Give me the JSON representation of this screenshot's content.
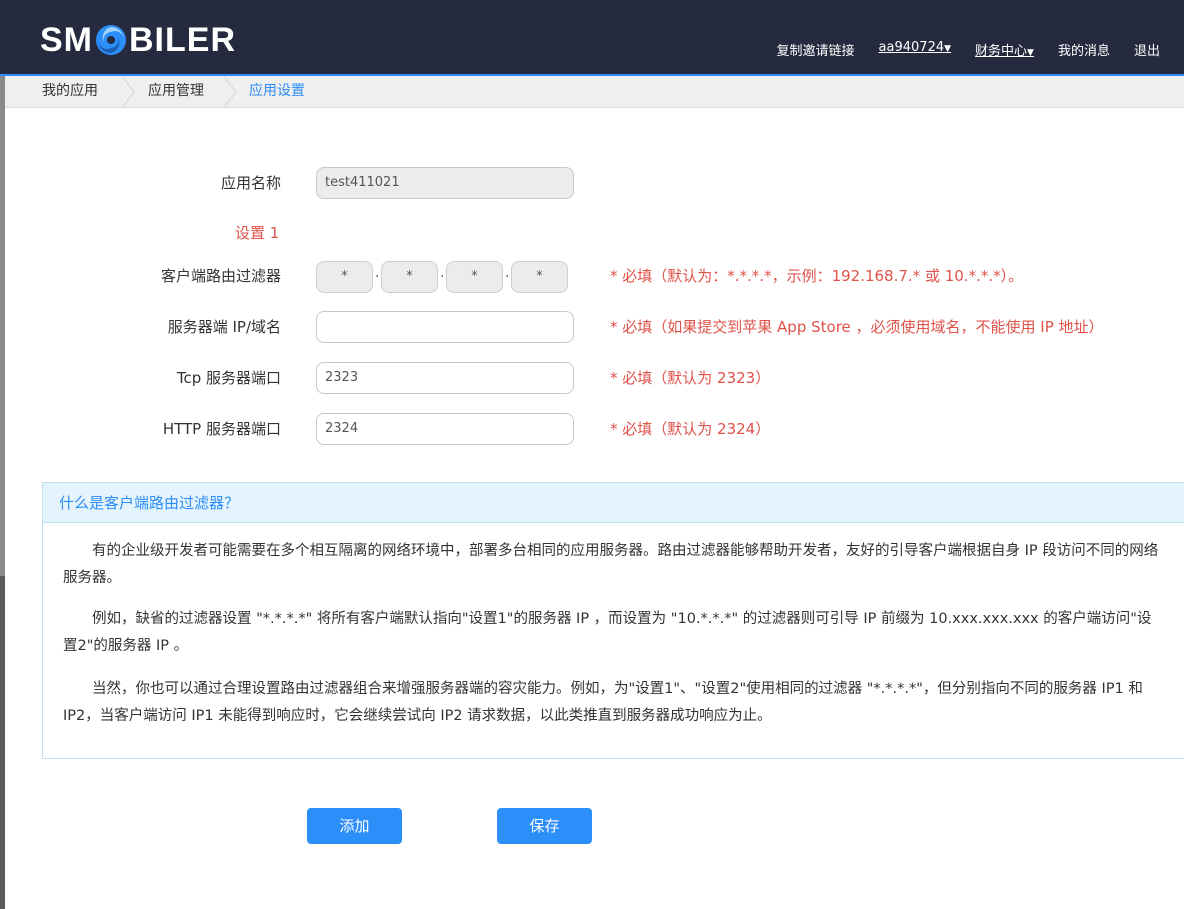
{
  "header": {
    "logo_left": "SM",
    "logo_right": "BILER",
    "nav": {
      "copy_invite": "复制邀请链接",
      "user": "aa940724",
      "finance": "财务中心",
      "messages": "我的消息",
      "logout": "退出"
    }
  },
  "breadcrumb": [
    "我的应用",
    "应用管理",
    "应用设置"
  ],
  "form": {
    "app_name_label": "应用名称",
    "app_name_value": "test411021",
    "section_title": "设置 1",
    "filter_label": "客户端路由过滤器",
    "filter_segments": [
      "*",
      "*",
      "*",
      "*"
    ],
    "filter_hint": "* 必填（默认为：*.*.*.*，示例：192.168.7.* 或 10.*.*.*）。",
    "server_ip_label": "服务器端 IP/域名",
    "server_ip_value": "",
    "server_ip_hint": "* 必填（如果提交到苹果 App Store ，必须使用域名，不能使用 IP 地址）",
    "tcp_label": "Tcp 服务器端口",
    "tcp_value": "2323",
    "tcp_hint": "* 必填（默认为 2323）",
    "http_label": "HTTP 服务器端口",
    "http_value": "2324",
    "http_hint": "* 必填（默认为 2324）"
  },
  "info": {
    "title": "什么是客户端路由过滤器？",
    "paragraphs": [
      "有的企业级开发者可能需要在多个相互隔离的网络环境中，部署多台相同的应用服务器。路由过滤器能够帮助开发者，友好的引导客户端根据自身 IP 段访问不同的网络服务器。",
      "例如，缺省的过滤器设置 \"*.*.*.*\" 将所有客户端默认指向\"设置1\"的服务器 IP ，而设置为 \"10.*.*.*\" 的过滤器则可引导 IP 前缀为 10.xxx.xxx.xxx 的客户端访问\"设置2\"的服务器 IP 。",
      "当然，你也可以通过合理设置路由过滤器组合来增强服务器端的容灾能力。例如，为\"设置1\"、\"设置2\"使用相同的过滤器 \"*.*.*.*\"，但分别指向不同的服务器 IP1 和 IP2，当客户端访问 IP1 未能得到响应时，它会继续尝试向 IP2 请求数据，以此类推直到服务器成功响应为止。"
    ]
  },
  "buttons": {
    "add": "添加",
    "save": "保存"
  },
  "colors": {
    "header_bg": "#252a3f",
    "accent": "#2c8ef8",
    "required_red": "#e0524a"
  }
}
